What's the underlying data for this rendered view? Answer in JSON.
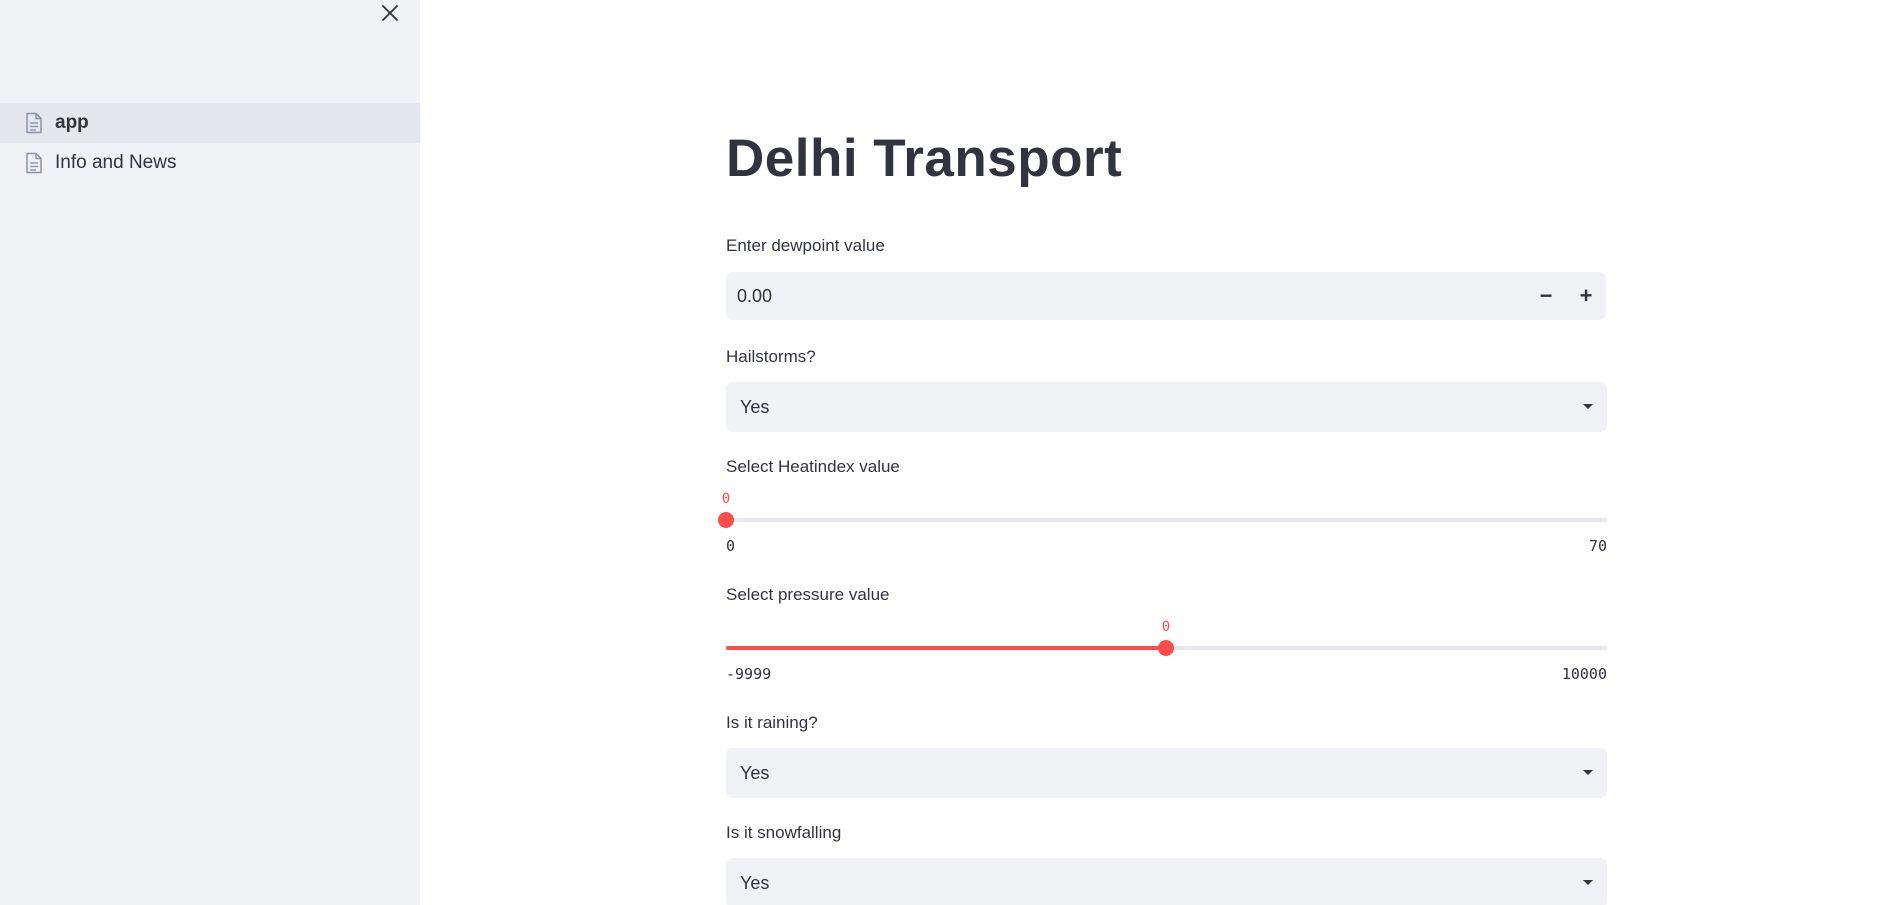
{
  "sidebar": {
    "close_icon": "close-icon",
    "items": [
      {
        "label": "app",
        "icon": "document-icon",
        "active": true
      },
      {
        "label": "Info and News",
        "icon": "document-icon",
        "active": false
      }
    ]
  },
  "main": {
    "title": "Delhi Transport",
    "dewpoint": {
      "label": "Enter dewpoint value",
      "value": "0.00",
      "minus": "−",
      "plus": "+"
    },
    "hailstorms": {
      "label": "Hailstorms?",
      "value": "Yes"
    },
    "heatindex": {
      "label": "Select Heatindex value",
      "value": "0",
      "min": "0",
      "max": "70",
      "fraction": 0
    },
    "pressure": {
      "label": "Select pressure value",
      "value": "0",
      "min": "-9999",
      "max": "10000",
      "fraction": 0.49997
    },
    "raining": {
      "label": "Is it raining?",
      "value": "Yes"
    },
    "snowfalling": {
      "label": "Is it snowfalling",
      "value": "Yes"
    }
  },
  "colors": {
    "accent": "#ff4b4b",
    "sidebar_bg": "#f0f2f6",
    "text": "#31333f"
  }
}
